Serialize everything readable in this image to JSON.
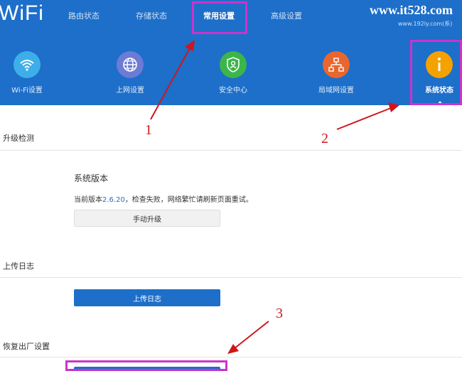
{
  "header": {
    "logo": "WiFi",
    "tabs": [
      {
        "label": "路由状态",
        "active": false
      },
      {
        "label": "存储状态",
        "active": false
      },
      {
        "label": "常用设置",
        "active": true
      },
      {
        "label": "高级设置",
        "active": false
      }
    ],
    "watermark": "www.it528.com",
    "watermark_sub": "www.192ly.com(系)",
    "bg_color": "#1d6fc9"
  },
  "icons": [
    {
      "label": "Wi-Fi设置",
      "icon": "wifi-icon",
      "color": "#3daee9"
    },
    {
      "label": "上网设置",
      "icon": "globe-icon",
      "color": "#6c7bd6"
    },
    {
      "label": "安全中心",
      "icon": "shield-icon",
      "color": "#3db54a"
    },
    {
      "label": "局域网设置",
      "icon": "network-icon",
      "color": "#e8672f"
    },
    {
      "label": "系统状态",
      "icon": "info-icon",
      "color": "#f5a100",
      "active": true
    }
  ],
  "upgrade": {
    "title": "升级检测",
    "version_label": "系统版本",
    "status_prefix": "当前版本",
    "version": "2.6.20",
    "status_suffix": "，检查失败，网络繁忙请刷新页面重试。",
    "button": "手动升级"
  },
  "log": {
    "title": "上传日志",
    "button": "上传日志"
  },
  "factory": {
    "title": "恢复出厂设置"
  },
  "annotations": {
    "numbers": [
      "1",
      "2",
      "3"
    ],
    "highlight_color": "#cc33cc",
    "arrow_color": "#d0161b"
  }
}
